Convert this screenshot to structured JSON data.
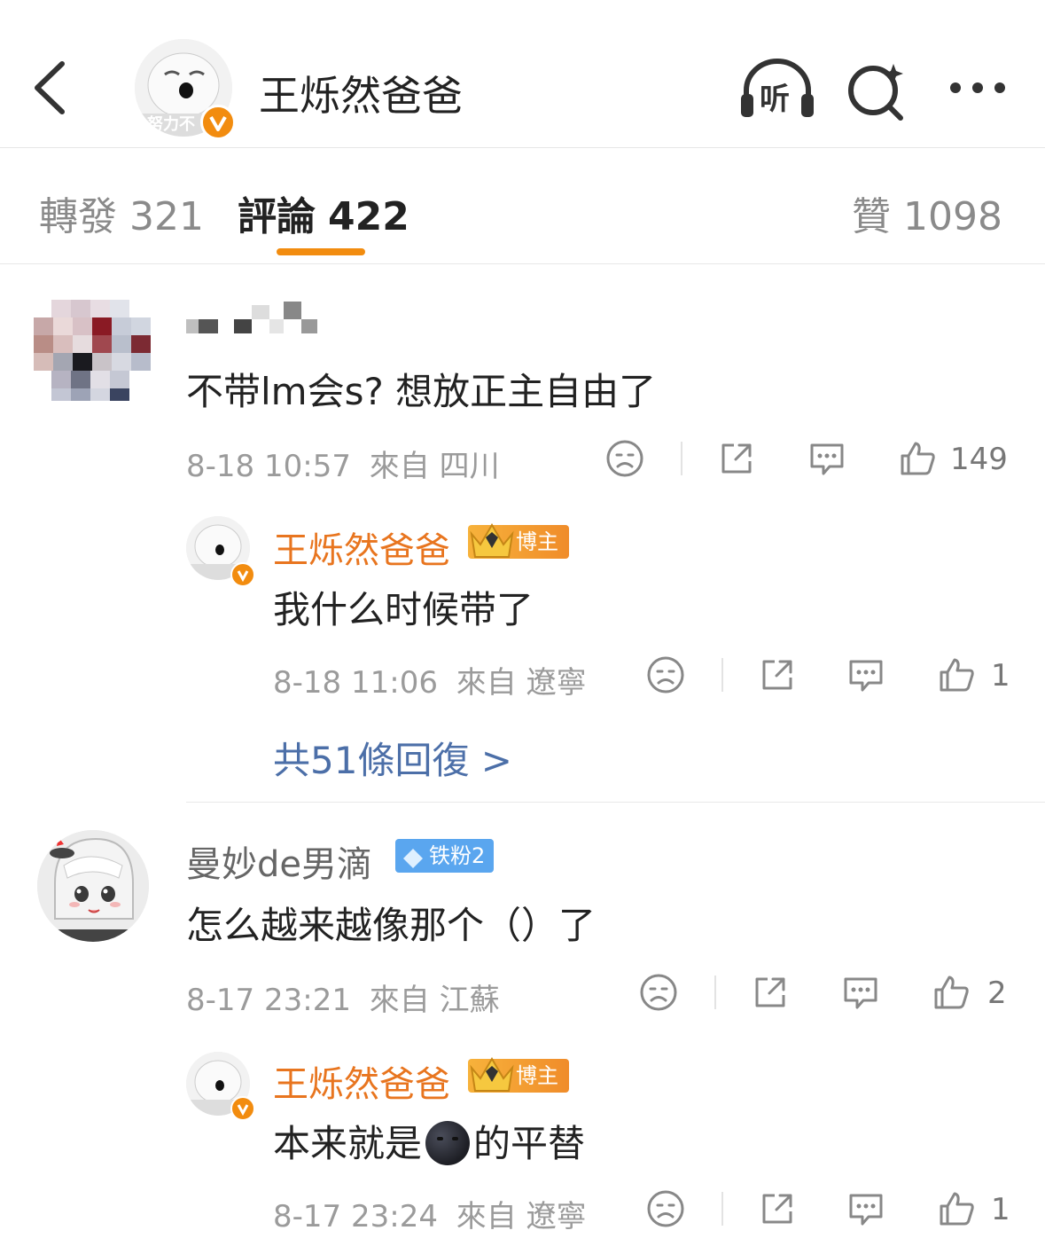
{
  "header": {
    "title": "王烁然爸爸",
    "avatar_caption": "努力不",
    "listen_label": "听"
  },
  "tabs": {
    "repost_label": "轉發",
    "repost_count": "321",
    "comment_label": "評論",
    "comment_count": "422",
    "like_label": "贊",
    "like_count": "1098"
  },
  "comments": [
    {
      "text": "不带lm会s? 想放正主自由了",
      "time": "8-18 10:57",
      "from": "來自 四川",
      "likes": "149",
      "reply": {
        "name": "王烁然爸爸",
        "badge": "博主",
        "text": "我什么时候带了",
        "time": "8-18 11:06",
        "from": "來自 遼寧",
        "likes": "1"
      },
      "more_replies": "共51條回復 >"
    },
    {
      "name": "曼妙de男滴",
      "badge": "铁粉2",
      "text": "怎么越来越像那个（）了",
      "time": "8-17 23:21",
      "from": "來自 江蘇",
      "likes": "2",
      "reply": {
        "name": "王烁然爸爸",
        "badge": "博主",
        "text_before": "本来就是",
        "text_after": "的平替",
        "time": "8-17 23:24",
        "from": "來自 遼寧",
        "likes": "1"
      }
    }
  ],
  "colors": {
    "accent": "#f28c0f",
    "author_name": "#e8751f",
    "more_link": "#4c6fa8",
    "tie_badge": "#5aa6ef"
  }
}
